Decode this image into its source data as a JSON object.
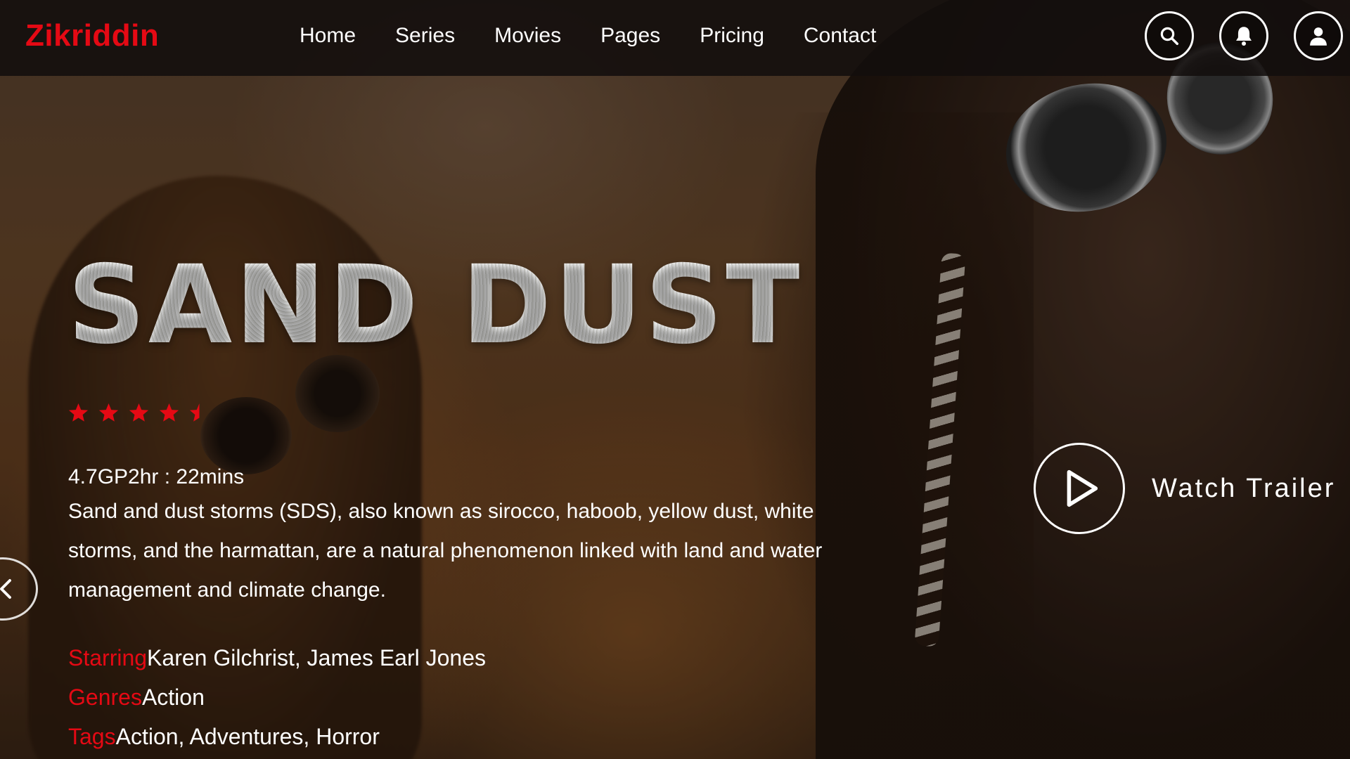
{
  "brand": {
    "name": "Zikriddin",
    "color": "#e50914"
  },
  "nav": {
    "links": [
      "Home",
      "Series",
      "Movies",
      "Pages",
      "Pricing",
      "Contact"
    ],
    "icons": [
      "search-icon",
      "bell-icon",
      "user-icon"
    ]
  },
  "movie": {
    "title": "SAND DUST",
    "rating": 4.7,
    "rating_max": 5,
    "meta": "4.7GP2hr : 22mins",
    "description": "Sand and dust storms (SDS), also known as sirocco, haboob, yellow dust, white storms, and the harmattan, are a natural phenomenon linked with land and water management and climate change.",
    "starring_label": "Starring",
    "starring": "Karen Gilchrist, James Earl Jones",
    "genres_label": "Genres",
    "genres": "Action",
    "tags_label": "Tags",
    "tags": "Action, Adventures, Horror"
  },
  "watch_trailer": {
    "label": "Watch Trailer",
    "icon": "play-icon"
  },
  "carousel": {
    "prev_icon": "chevron-left-icon"
  }
}
